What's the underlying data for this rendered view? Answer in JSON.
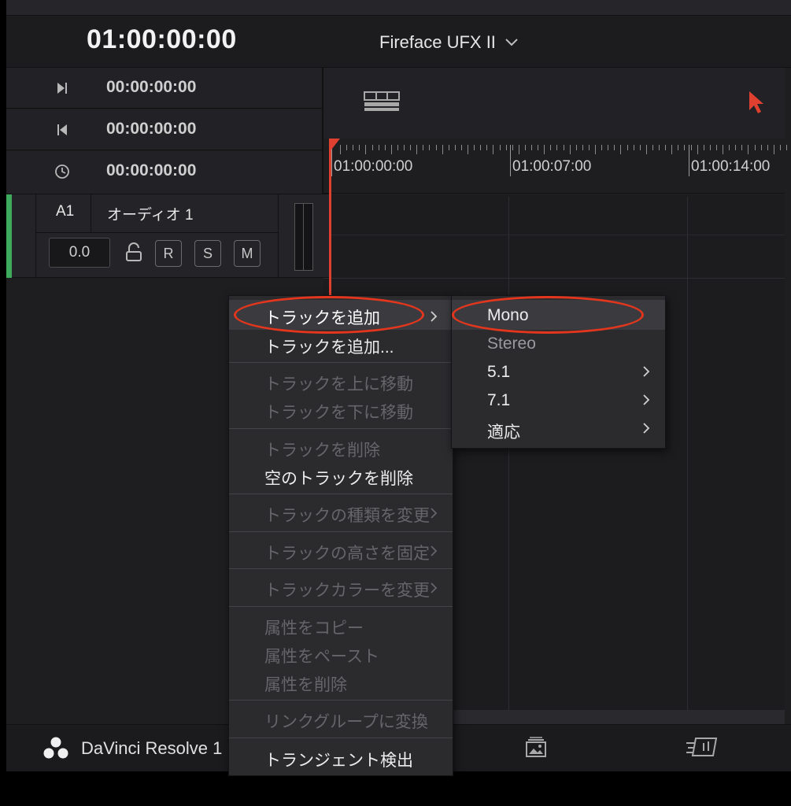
{
  "header": {
    "main_timecode": "01:00:00:00",
    "device": "Fireface UFX II"
  },
  "timecodes": [
    {
      "icon": "mark-in-icon",
      "value": "00:00:00:00"
    },
    {
      "icon": "mark-out-icon",
      "value": "00:00:00:00"
    },
    {
      "icon": "clock-icon",
      "value": "00:00:00:00"
    }
  ],
  "ruler": {
    "labels": [
      "01:00:00:00",
      "01:00:07:00",
      "01:00:14:00"
    ]
  },
  "track": {
    "id": "A1",
    "name": "オーディオ 1",
    "volume": "0.0",
    "buttons": [
      "R",
      "S",
      "M"
    ],
    "color": "#3daa5d"
  },
  "context_menu": {
    "items": [
      {
        "label": "トラックを追加",
        "state": "highlighted",
        "submenu": true
      },
      {
        "label": "トラックを追加...",
        "state": "enabled"
      },
      {
        "label": "トラックを上に移動",
        "state": "disabled"
      },
      {
        "label": "トラックを下に移動",
        "state": "disabled"
      },
      {
        "label": "トラックを削除",
        "state": "disabled"
      },
      {
        "label": "空のトラックを削除",
        "state": "enabled"
      },
      {
        "label": "トラックの種類を変更",
        "state": "disabled",
        "submenu": true
      },
      {
        "label": "トラックの高さを固定",
        "state": "disabled",
        "submenu": true
      },
      {
        "label": "トラックカラーを変更",
        "state": "disabled",
        "submenu": true
      },
      {
        "label": "属性をコピー",
        "state": "disabled"
      },
      {
        "label": "属性をペースト",
        "state": "disabled"
      },
      {
        "label": "属性を削除",
        "state": "disabled"
      },
      {
        "label": "リンクグループに変換",
        "state": "disabled"
      },
      {
        "label": "トランジェント検出",
        "state": "enabled"
      }
    ]
  },
  "submenu": {
    "items": [
      {
        "label": "Mono",
        "state": "highlighted"
      },
      {
        "label": "Stereo",
        "state": "disabled"
      },
      {
        "label": "5.1",
        "state": "enabled",
        "submenu": true
      },
      {
        "label": "7.1",
        "state": "enabled",
        "submenu": true
      },
      {
        "label": "適応",
        "state": "enabled",
        "submenu": true
      }
    ]
  },
  "statusbar": {
    "app_name": "DaVinci Resolve 1"
  },
  "colors": {
    "accent_red": "#e04030",
    "annotation": "#e4361d"
  }
}
